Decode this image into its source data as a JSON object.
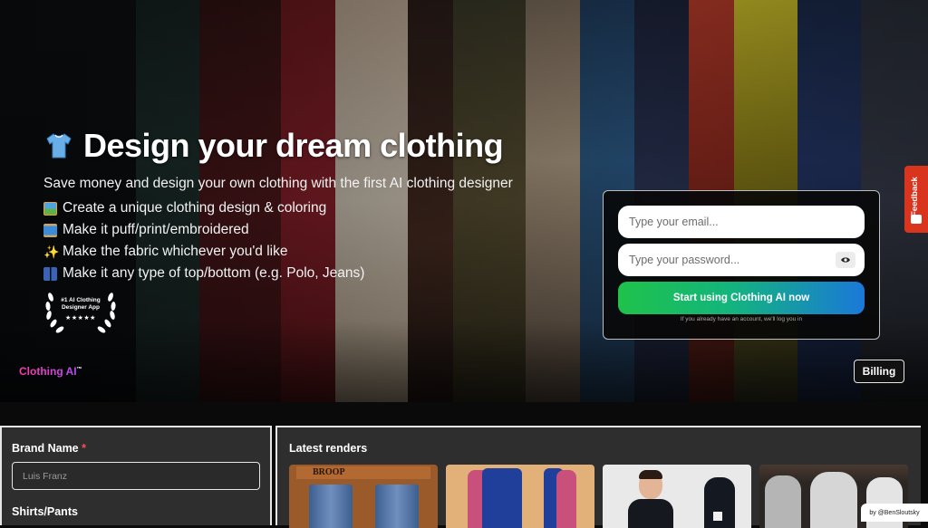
{
  "hero": {
    "headline": "Design your dream clothing",
    "subtitle": "Save money and design your own clothing with the first AI clothing designer",
    "features": [
      {
        "icon": "picture-icon",
        "color": "#e2a23b",
        "text": "Create a unique clothing design & coloring"
      },
      {
        "icon": "thread-spool-icon",
        "color": "#3c8bd6",
        "text": "Make it puff/print/embroidered"
      },
      {
        "icon": "sparkles-icon",
        "color": "#f1c232",
        "text": "Make the fabric whichever you'd like"
      },
      {
        "icon": "jeans-icon",
        "color": "#3a62b5",
        "text": "Make it any type of top/bottom (e.g. Polo, Jeans)"
      }
    ],
    "award": {
      "text": "#1 AI Clothing Designer App",
      "stars": "★★★★★"
    }
  },
  "signup": {
    "email_placeholder": "Type your email...",
    "password_placeholder": "Type your password...",
    "cta_label": "Start using Clothing AI now",
    "note": "If you already have an account, we'll log you in"
  },
  "brand": {
    "name": "Clothing AI",
    "mark": "™"
  },
  "billing_label": "Billing",
  "feedback_label": "Feedback",
  "form": {
    "brand_name_label": "Brand Name",
    "required_mark": "*",
    "brand_name_placeholder": "Luis Franz",
    "shirts_pants_label": "Shirts/Pants"
  },
  "renders": {
    "title": "Latest renders",
    "items": [
      {
        "caption": "BROOP"
      },
      {
        "caption": ""
      },
      {
        "caption": ""
      },
      {
        "caption": ""
      }
    ]
  },
  "credit": "by @BenSloutsky",
  "colors": {
    "accent_green": "#1fc24a",
    "accent_blue": "#1a78d9",
    "brand_pink": "#ff3aa6",
    "feedback_red": "#d9341e"
  }
}
